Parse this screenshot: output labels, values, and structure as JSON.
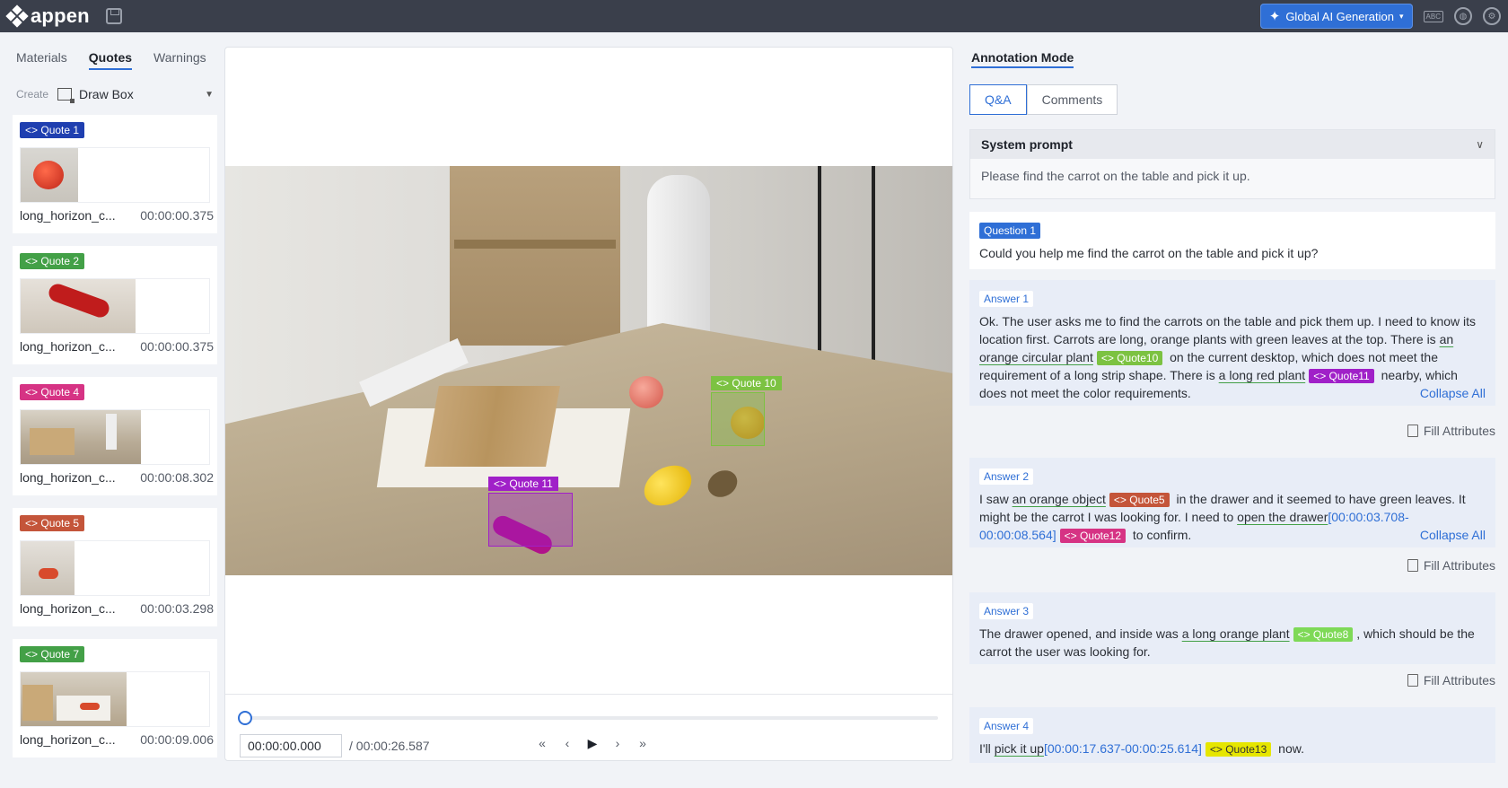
{
  "topbar": {
    "brand": "appen",
    "global_ai_label": "Global AI Generation",
    "abc_label": "ABC"
  },
  "left": {
    "tabs": [
      "Materials",
      "Quotes",
      "Warnings"
    ],
    "active_tab": "Quotes",
    "create_label": "Create",
    "tool_value": "Draw Box",
    "quotes": [
      {
        "tag": "Quote 1",
        "color": "#1f3fb0",
        "name": "long_horizon_c...",
        "time": "00:00:00.375"
      },
      {
        "tag": "Quote 2",
        "color": "#43a047",
        "name": "long_horizon_c...",
        "time": "00:00:00.375"
      },
      {
        "tag": "Quote 4",
        "color": "#d63384",
        "name": "long_horizon_c...",
        "time": "00:00:08.302"
      },
      {
        "tag": "Quote 5",
        "color": "#c4553a",
        "name": "long_horizon_c...",
        "time": "00:00:03.298"
      },
      {
        "tag": "Quote 7",
        "color": "#43a047",
        "name": "long_horizon_c...",
        "time": "00:00:09.006"
      }
    ]
  },
  "video": {
    "boxes": [
      {
        "label": "Quote 10",
        "color": "#7cc242"
      },
      {
        "label": "Quote 11",
        "color": "#a020c8"
      }
    ],
    "current_time": "00:00:00.000",
    "total_time": "/ 00:00:26.587",
    "progress": 0
  },
  "right": {
    "mode_title": "Annotation Mode",
    "tabs": [
      "Q&A",
      "Comments"
    ],
    "active_tab": "Q&A",
    "system_prompt_title": "System prompt",
    "system_prompt": "Please find the carrot on the table and pick it up.",
    "question": {
      "tag": "Question 1",
      "text": "Could you help me find the carrot on the table and pick it up?"
    },
    "fill_attributes": "Fill Attributes",
    "collapse_all": "Collapse All",
    "answers": [
      {
        "tag": "Answer 1",
        "t1": "Ok. The user asks me to find the carrots on the table and pick them up. I need to know its location first. Carrots are long, orange plants with green leaves at the top. There is ",
        "u1": "an orange circular plant",
        "c1": "<> Quote10",
        "t2": " on the current desktop, which does not meet the requirement of a long strip shape. There is ",
        "u2": "a long red plant",
        "c2": "<> Quote11",
        "t3": " nearby, which does not meet the color requirements."
      },
      {
        "tag": "Answer 2",
        "t1": "I saw ",
        "u1": "an orange object",
        "c1": "<> Quote5",
        "t2": " in the drawer and it seemed to have green leaves. It might be the carrot I was looking for. I need to ",
        "u2": "open the drawer",
        "range": "[00:00:03.708-00:00:08.564]",
        "c2": "<> Quote12",
        "t3": " to confirm."
      },
      {
        "tag": "Answer 3",
        "t1": "The drawer opened, and inside was ",
        "u1": "a long orange plant",
        "c1": "<> Quote8",
        "t2": ", which should be the carrot the user was looking for."
      },
      {
        "tag": "Answer 4",
        "t1": "I'll ",
        "u1": "pick it up",
        "range": "[00:00:17.637-00:00:25.614]",
        "c1": "<> Quote13",
        "t2": " now."
      }
    ]
  },
  "colors": {
    "accent": "#2f6fd6",
    "quote10": "#7cc242",
    "quote11": "#a020c8",
    "quote5": "#c4553a",
    "quote12": "#d63384",
    "quote8": "#7ed957",
    "quote13": "#e6e600"
  }
}
